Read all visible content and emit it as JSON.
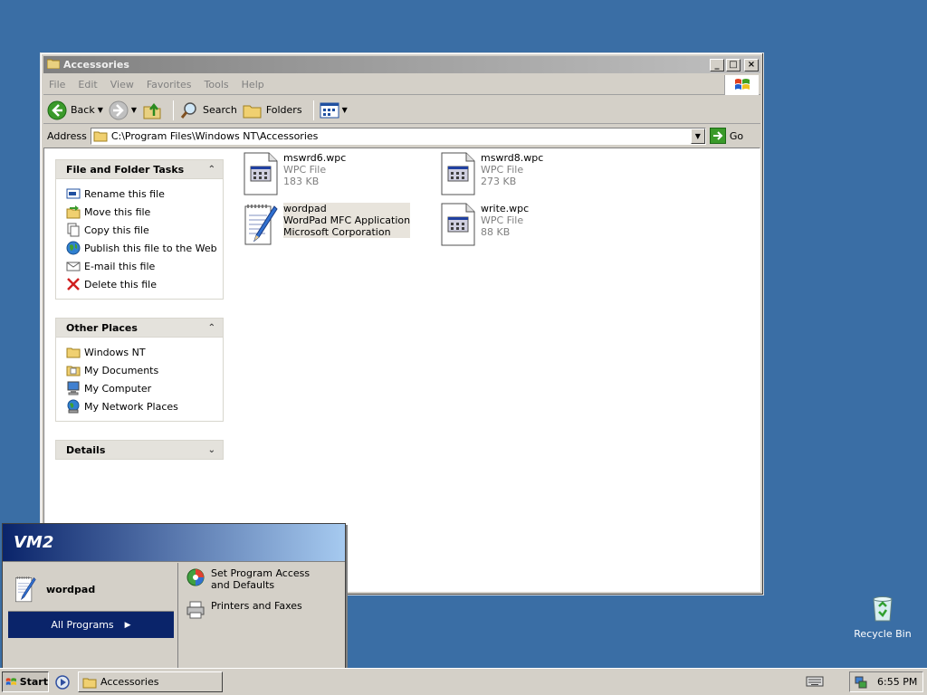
{
  "window": {
    "title": "Accessories",
    "menu": [
      "File",
      "Edit",
      "View",
      "Favorites",
      "Tools",
      "Help"
    ],
    "toolbar": {
      "back": "Back",
      "search": "Search",
      "folders": "Folders"
    },
    "address": {
      "label": "Address",
      "value": "C:\\Program Files\\Windows NT\\Accessories",
      "go": "Go"
    }
  },
  "tasks": {
    "file_folder": {
      "title": "File and Folder Tasks",
      "items": [
        "Rename this file",
        "Move this file",
        "Copy this file",
        "Publish this file to the Web",
        "E-mail this file",
        "Delete this file"
      ]
    },
    "other_places": {
      "title": "Other Places",
      "items": [
        "Windows NT",
        "My Documents",
        "My Computer",
        "My Network Places"
      ]
    },
    "details": {
      "title": "Details"
    }
  },
  "files": [
    {
      "name": "mswrd6.wpc",
      "type": "WPC File",
      "size": "183 KB"
    },
    {
      "name": "mswrd8.wpc",
      "type": "WPC File",
      "size": "273 KB"
    },
    {
      "name": "wordpad",
      "type": "WordPad MFC Application",
      "size": "Microsoft Corporation"
    },
    {
      "name": "write.wpc",
      "type": "WPC File",
      "size": "88 KB"
    }
  ],
  "start_menu": {
    "user": "VM2",
    "pinned": "wordpad",
    "all_programs": "All Programs",
    "right_items": [
      "Set Program Access and Defaults",
      "Printers and Faxes"
    ]
  },
  "taskbar": {
    "start": "Start",
    "task": "Accessories",
    "clock": "6:55 PM"
  },
  "desktop": {
    "recycle_bin": "Recycle Bin"
  }
}
